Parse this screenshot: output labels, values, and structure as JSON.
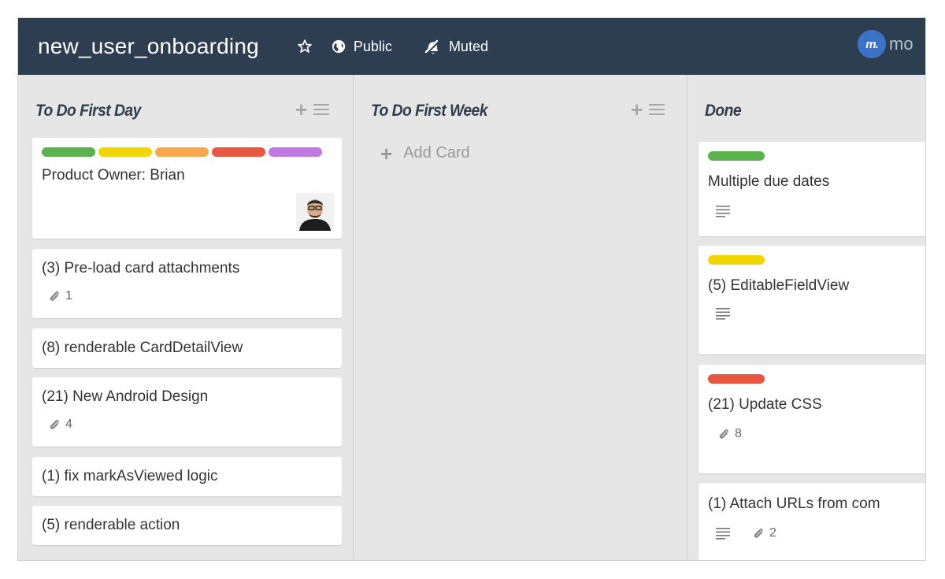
{
  "header": {
    "board_title": "new_user_onboarding",
    "visibility": "Public",
    "notifications": "Muted",
    "logo_mark": "m.",
    "logo_text": "mo"
  },
  "lists": [
    {
      "title": "To Do First Day",
      "cards": [
        {
          "title": "Product Owner: Brian",
          "labels": [
            "#5bb34d",
            "#f2d600",
            "#f9a94b",
            "#e8573f",
            "#c377e0"
          ],
          "has_avatar": true
        },
        {
          "title": "(3) Pre-load card attachments",
          "attachments": "1"
        },
        {
          "title": "(8) renderable CardDetailView"
        },
        {
          "title": "(21) New Android Design",
          "attachments": "4"
        },
        {
          "title": "(1) fix markAsViewed logic"
        },
        {
          "title": "(5) renderable action"
        }
      ]
    },
    {
      "title": "To Do First Week",
      "add_card": "Add Card"
    },
    {
      "title": "Done",
      "cards": [
        {
          "title": "Multiple due dates",
          "labels": [
            "#5bb34d"
          ],
          "has_description": true
        },
        {
          "title": "(5) EditableFieldView",
          "labels": [
            "#f2d600"
          ],
          "has_description": true
        },
        {
          "title": "(21) Update CSS",
          "labels": [
            "#e8573f"
          ],
          "attachments": "8"
        },
        {
          "title": "(1) Attach URLs from com",
          "has_description": true,
          "attachments": "2"
        }
      ]
    }
  ]
}
